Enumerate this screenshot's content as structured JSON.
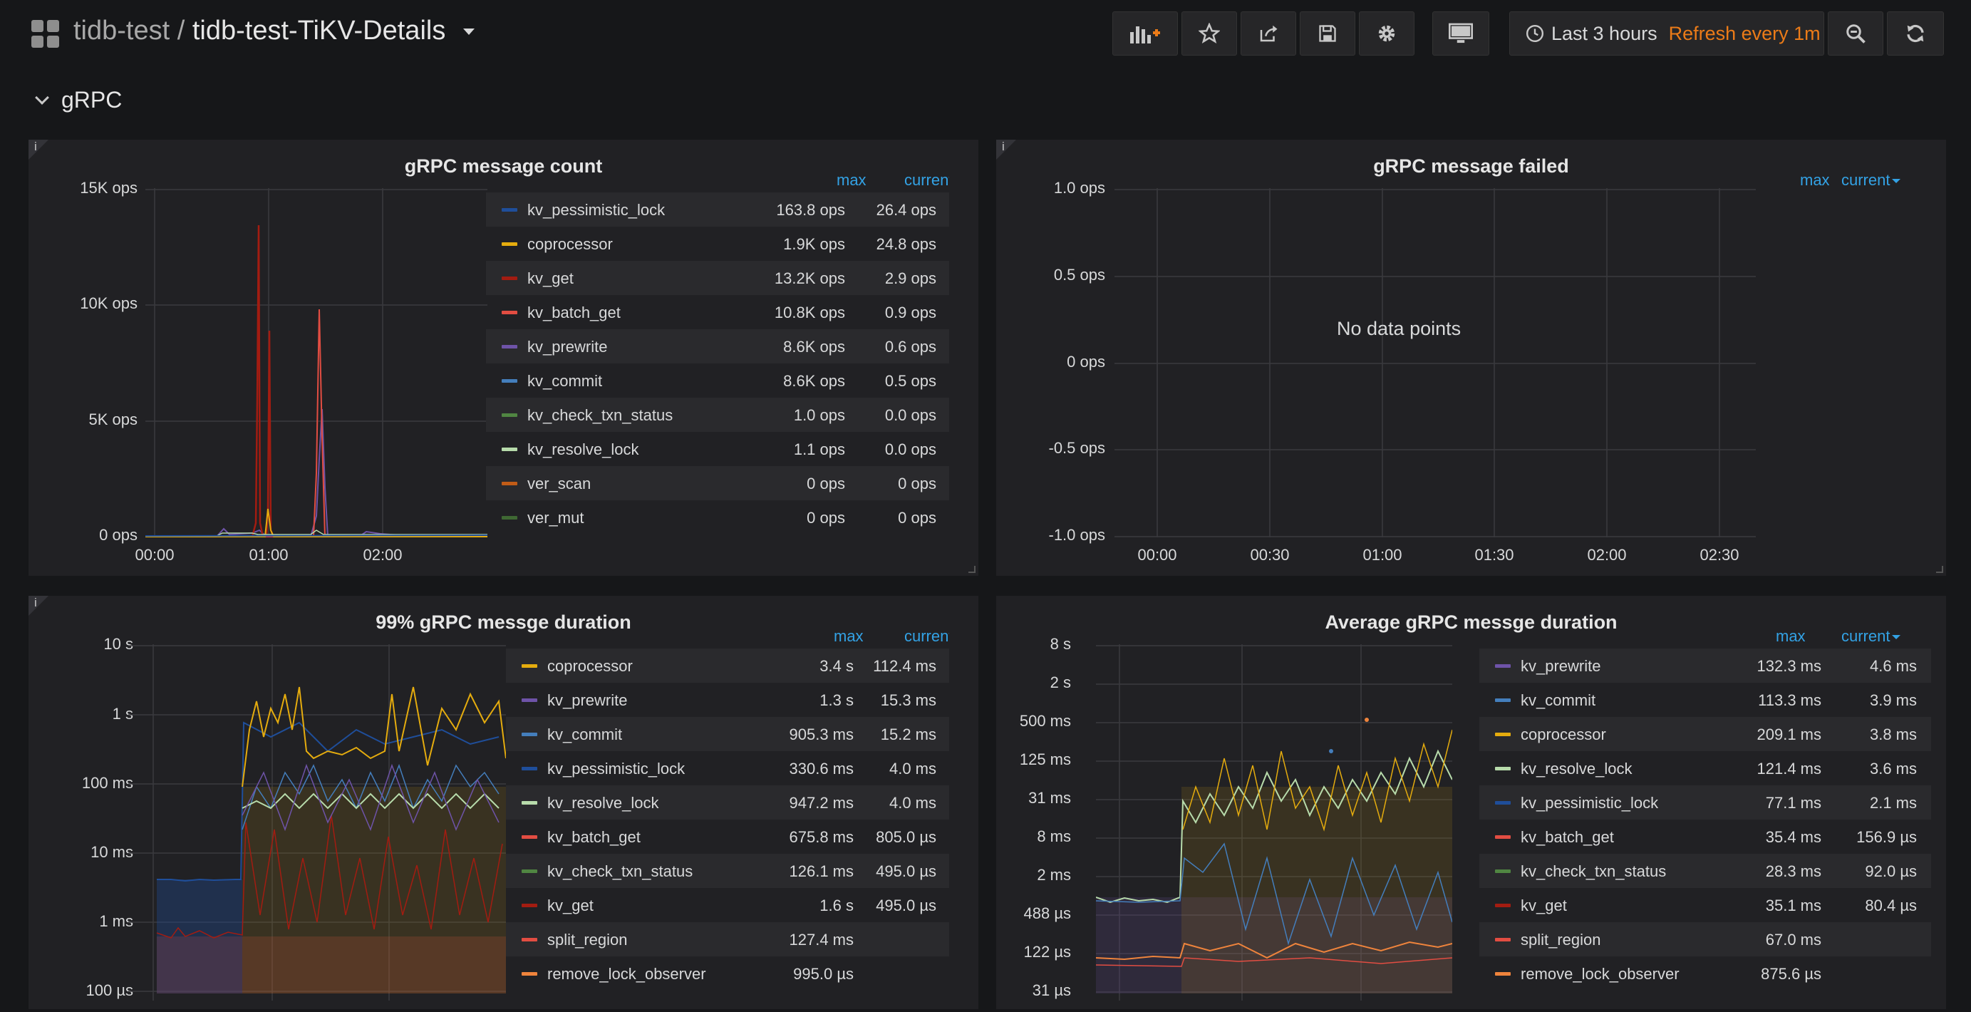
{
  "header": {
    "folder": "tidb-test",
    "separator": "/",
    "dashboard": "tidb-test-TiKV-Details",
    "time_range": "Last 3 hours",
    "refresh": "Refresh every 1m",
    "icons": [
      "add-panel-icon",
      "star-icon",
      "share-icon",
      "save-icon",
      "settings-icon",
      "tv-mode-icon",
      "clock-icon",
      "zoom-out-icon",
      "refresh-icon"
    ]
  },
  "row": {
    "title": "gRPC"
  },
  "colors": {
    "kv_pessimistic_lock": "#1f4e9a",
    "coprocessor": "#e5ac0e",
    "kv_get": "#a31c11",
    "kv_batch_get": "#e24d42",
    "kv_prewrite": "#6e53a8",
    "kv_commit": "#447ebc",
    "kv_check_txn_status": "#508642",
    "kv_resolve_lock": "#b7dbab",
    "ver_scan": "#c15c17",
    "ver_mut": "#3f6833",
    "split_region": "#e24d42",
    "remove_lock_observer": "#ef843c"
  },
  "panels": [
    {
      "title": "gRPC message count",
      "y_ticks": [
        "15K ops",
        "10K ops",
        "5K ops",
        "0 ops"
      ],
      "x_ticks": [
        "00:00",
        "01:00",
        "02:00"
      ],
      "legend_headers": {
        "max": "max",
        "current": "current"
      },
      "legend": [
        {
          "name": "kv_pessimistic_lock",
          "max": "163.8 ops",
          "current": "26.4 ops"
        },
        {
          "name": "coprocessor",
          "max": "1.9K ops",
          "current": "24.8 ops"
        },
        {
          "name": "kv_get",
          "max": "13.2K ops",
          "current": "2.9 ops"
        },
        {
          "name": "kv_batch_get",
          "max": "10.8K ops",
          "current": "0.9 ops"
        },
        {
          "name": "kv_prewrite",
          "max": "8.6K ops",
          "current": "0.6 ops"
        },
        {
          "name": "kv_commit",
          "max": "8.6K ops",
          "current": "0.5 ops"
        },
        {
          "name": "kv_check_txn_status",
          "max": "1.0 ops",
          "current": "0.0 ops"
        },
        {
          "name": "kv_resolve_lock",
          "max": "1.1 ops",
          "current": "0.0 ops"
        },
        {
          "name": "ver_scan",
          "max": "0 ops",
          "current": "0 ops"
        },
        {
          "name": "ver_mut",
          "max": "0 ops",
          "current": "0 ops"
        }
      ]
    },
    {
      "title": "gRPC message failed",
      "y_ticks": [
        "1.0 ops",
        "0.5 ops",
        "0 ops",
        "-0.5 ops",
        "-1.0 ops"
      ],
      "x_ticks": [
        "00:00",
        "00:30",
        "01:00",
        "01:30",
        "02:00",
        "02:30"
      ],
      "legend_headers": {
        "max": "max",
        "current": "current"
      },
      "no_data": "No data points"
    },
    {
      "title": "99% gRPC messge duration",
      "y_ticks": [
        "10 s",
        "1 s",
        "100 ms",
        "10 ms",
        "1 ms",
        "100 µs"
      ],
      "legend_headers": {
        "max": "max",
        "current": "current"
      },
      "legend": [
        {
          "name": "coprocessor",
          "max": "3.4 s",
          "current": "112.4 ms"
        },
        {
          "name": "kv_prewrite",
          "max": "1.3 s",
          "current": "15.3 ms"
        },
        {
          "name": "kv_commit",
          "max": "905.3 ms",
          "current": "15.2 ms"
        },
        {
          "name": "kv_pessimistic_lock",
          "max": "330.6 ms",
          "current": "4.0 ms"
        },
        {
          "name": "kv_resolve_lock",
          "max": "947.2 ms",
          "current": "4.0 ms"
        },
        {
          "name": "kv_batch_get",
          "max": "675.8 ms",
          "current": "805.0 µs"
        },
        {
          "name": "kv_check_txn_status",
          "max": "126.1 ms",
          "current": "495.0 µs"
        },
        {
          "name": "kv_get",
          "max": "1.6 s",
          "current": "495.0 µs"
        },
        {
          "name": "split_region",
          "max": "127.4 ms",
          "current": ""
        },
        {
          "name": "remove_lock_observer",
          "max": "995.0 µs",
          "current": ""
        }
      ]
    },
    {
      "title": "Average gRPC messge duration",
      "y_ticks": [
        "8 s",
        "2 s",
        "500 ms",
        "125 ms",
        "31 ms",
        "8 ms",
        "2 ms",
        "488 µs",
        "122 µs",
        "31 µs"
      ],
      "legend_headers": {
        "max": "max",
        "current": "current"
      },
      "legend": [
        {
          "name": "kv_prewrite",
          "max": "132.3 ms",
          "current": "4.6 ms"
        },
        {
          "name": "kv_commit",
          "max": "113.3 ms",
          "current": "3.9 ms"
        },
        {
          "name": "coprocessor",
          "max": "209.1 ms",
          "current": "3.8 ms"
        },
        {
          "name": "kv_resolve_lock",
          "max": "121.4 ms",
          "current": "3.6 ms"
        },
        {
          "name": "kv_pessimistic_lock",
          "max": "77.1 ms",
          "current": "2.1 ms"
        },
        {
          "name": "kv_batch_get",
          "max": "35.4 ms",
          "current": "156.9 µs"
        },
        {
          "name": "kv_check_txn_status",
          "max": "28.3 ms",
          "current": "92.0 µs"
        },
        {
          "name": "kv_get",
          "max": "35.1 ms",
          "current": "80.4 µs"
        },
        {
          "name": "split_region",
          "max": "67.0 ms",
          "current": ""
        },
        {
          "name": "remove_lock_observer",
          "max": "875.6 µs",
          "current": ""
        }
      ]
    }
  ]
}
